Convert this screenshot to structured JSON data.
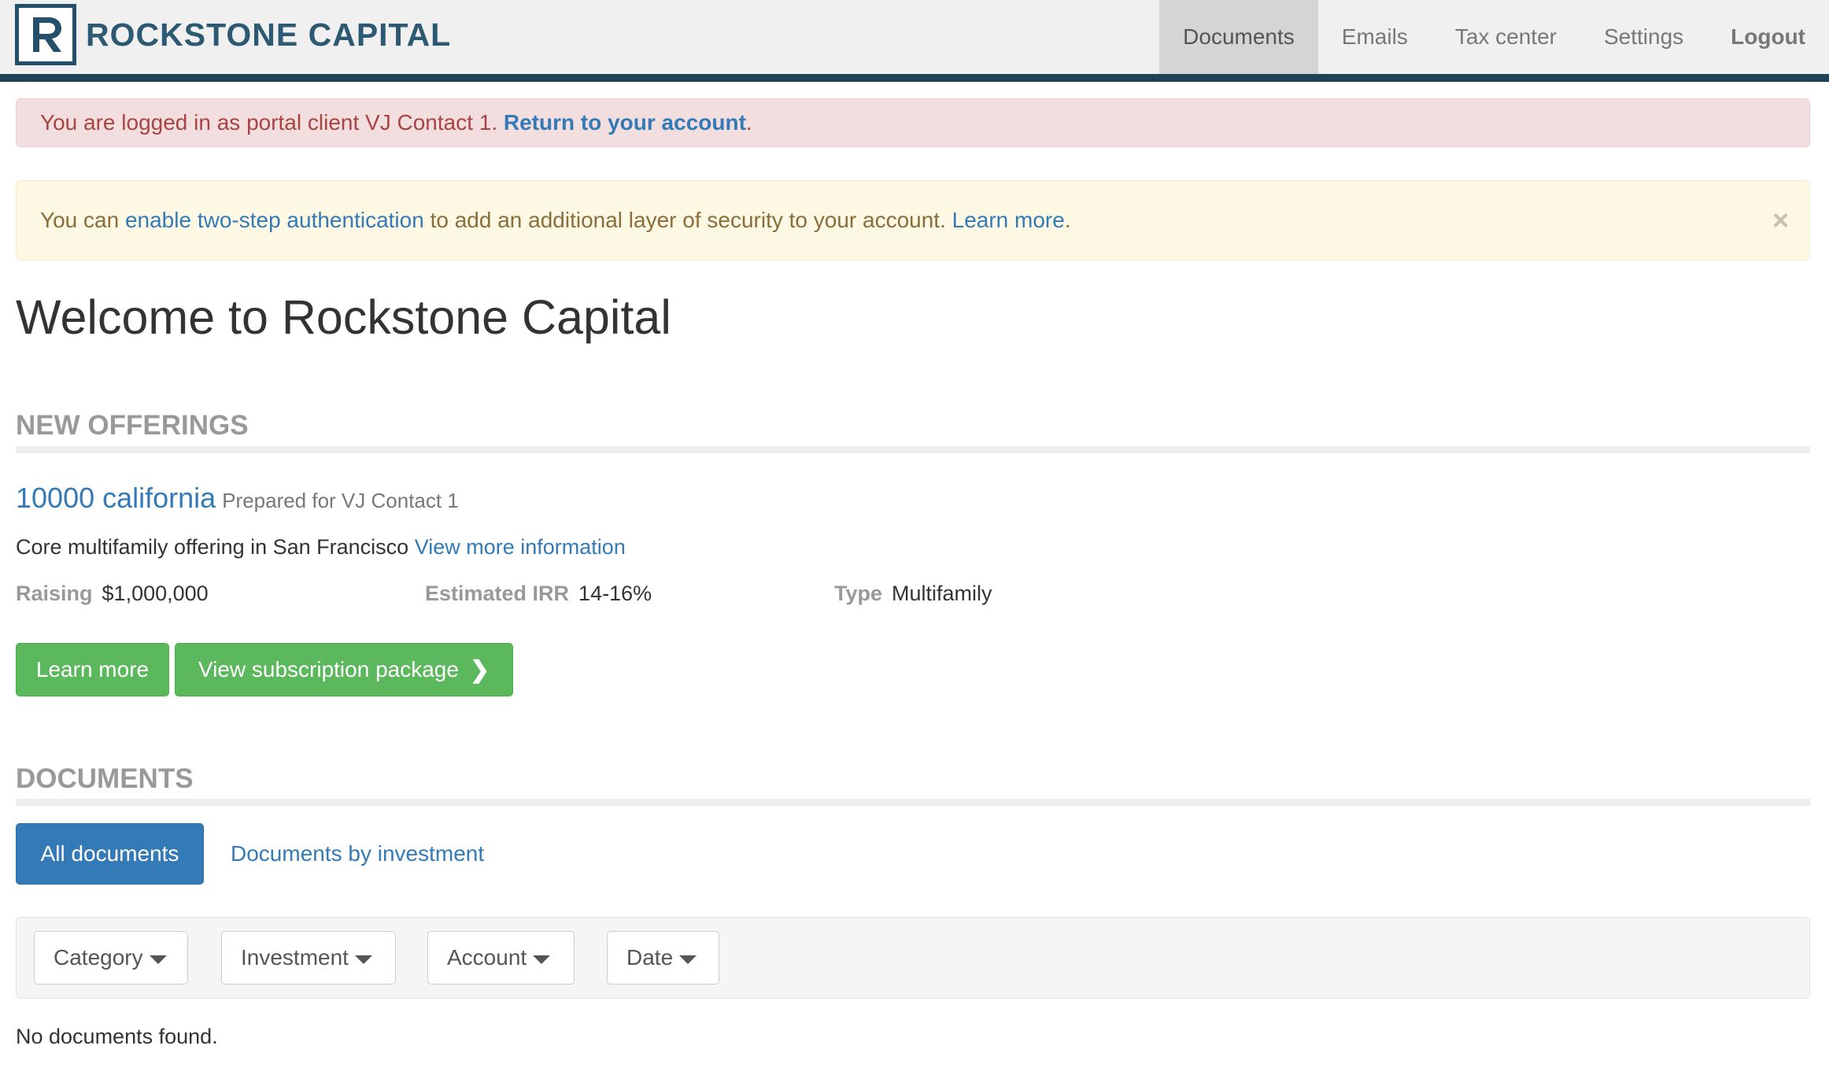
{
  "brand": {
    "logo_letter": "R",
    "name": "ROCKSTONE CAPITAL"
  },
  "nav": {
    "items": [
      {
        "label": "Documents",
        "active": true
      },
      {
        "label": "Emails",
        "active": false
      },
      {
        "label": "Tax center",
        "active": false
      },
      {
        "label": "Settings",
        "active": false
      },
      {
        "label": "Logout",
        "active": false
      }
    ]
  },
  "alerts": {
    "impersonation": {
      "text": "You are logged in as portal client VJ Contact 1.",
      "link": "Return to your account",
      "suffix": "."
    },
    "two_step": {
      "prefix": "You can",
      "link": "enable two-step authentication",
      "middle": "to add an additional layer of security to your account.",
      "learn_more": "Learn more",
      "suffix": ".",
      "close": "×"
    }
  },
  "page": {
    "title": "Welcome to Rockstone Capital"
  },
  "new_offerings": {
    "heading": "NEW OFFERINGS",
    "offering": {
      "name": "10000 california",
      "prepared_for": "Prepared for VJ Contact 1",
      "description": "Core multifamily offering in San Francisco",
      "more_info": "View more information",
      "stats": [
        {
          "label": "Raising",
          "value": "$1,000,000"
        },
        {
          "label": "Estimated IRR",
          "value": "14-16%"
        },
        {
          "label": "Type",
          "value": "Multifamily"
        }
      ],
      "learn_more_button": "Learn more",
      "subscription_button": "View subscription package",
      "subscription_icon": "chevron-right-icon"
    }
  },
  "documents": {
    "heading": "DOCUMENTS",
    "tabs": [
      {
        "label": "All documents",
        "active": true
      },
      {
        "label": "Documents by investment",
        "active": false
      }
    ],
    "filters": [
      "Category",
      "Investment",
      "Account",
      "Date"
    ],
    "empty_message": "No documents found."
  },
  "colors": {
    "brand": "#2d5a72",
    "navbar_rule": "#1f4257",
    "link": "#337ab7",
    "success": "#5cb85c",
    "primary": "#337ab7",
    "danger_bg": "#f2dede",
    "warning_bg": "#fcf8e3"
  }
}
